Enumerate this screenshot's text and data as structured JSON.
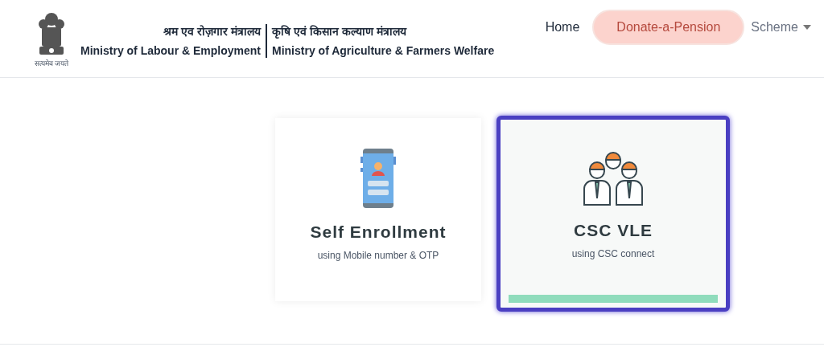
{
  "header": {
    "emblem_motto": "सत्यमेव जयते",
    "ministries": [
      {
        "hindi": "श्रम एव रोज़गार मंत्रालय",
        "english": "Ministry of Labour & Employment"
      },
      {
        "hindi": "कृषि एवं किसान कल्याण मंत्रालय",
        "english": "Ministry of Agriculture & Farmers Welfare"
      }
    ]
  },
  "nav": [
    {
      "kind": "link",
      "label": "Home"
    },
    {
      "kind": "button",
      "label": "Donate-a-Pension"
    },
    {
      "kind": "dropdown",
      "label": "Scheme"
    }
  ],
  "options": [
    {
      "kind": "phone",
      "title": "Self Enrollment",
      "subtitle": "using Mobile number & OTP",
      "selected": false
    },
    {
      "kind": "people",
      "title": "CSC VLE",
      "subtitle": "using CSC connect",
      "selected": true
    }
  ]
}
